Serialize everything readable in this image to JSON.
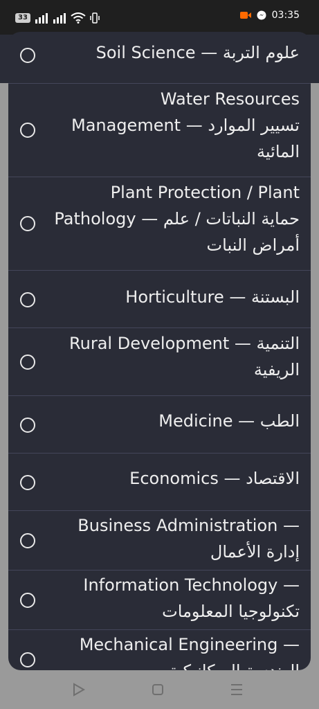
{
  "status_bar": {
    "battery": "33",
    "time": "03:35",
    "icons": [
      "signal-icon",
      "signal-icon",
      "wifi-icon",
      "vibrate-icon",
      "screen-record-icon",
      "messenger-icon"
    ]
  },
  "options": [
    {
      "lines": [
        "Soil Science — علوم التربة"
      ]
    },
    {
      "lines": [
        "Water Resources",
        "Management — تسيير الموارد",
        "المائية"
      ]
    },
    {
      "lines": [
        "Plant Protection / Plant",
        "Pathology — حماية النباتات / علم",
        "أمراض النبات"
      ]
    },
    {
      "lines": [
        "Horticulture — البستنة"
      ]
    },
    {
      "lines": [
        "Rural Development — التنمية",
        "الريفية"
      ]
    },
    {
      "lines": [
        "Medicine — الطب"
      ]
    },
    {
      "lines": [
        "Economics — الاقتصاد"
      ]
    },
    {
      "lines": [
        "Business Administration —",
        "إدارة الأعمال"
      ]
    },
    {
      "lines": [
        "Information Technology —",
        "تكنولوجيا المعلومات"
      ]
    },
    {
      "lines": [
        "Mechanical Engineering —",
        "الهندسة الميكانيكية"
      ]
    }
  ],
  "nav_bar": {
    "buttons": [
      "back-triangle-icon",
      "home-square-icon",
      "menu-lines-icon"
    ]
  }
}
